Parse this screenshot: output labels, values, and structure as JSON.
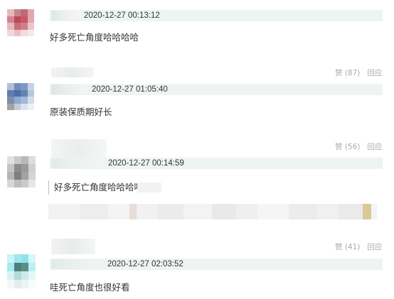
{
  "comments": [
    {
      "timestamp": "2020-12-27 00:13:12",
      "text": "好多死亡角度哈哈哈哈"
    },
    {
      "timestamp": "2020-12-27 01:05:40",
      "text": "原装保质期好长",
      "likes_label": "赞 (87)",
      "reply_label": "回应"
    },
    {
      "timestamp": "2020-12-27 00:14:59",
      "quote_text": "好多死亡角度哈哈哈哈",
      "likes_label": "赞 (56)",
      "reply_label": "回应"
    },
    {
      "timestamp": "2020-12-27 02:03:52",
      "text": "哇死亡角度也很好看",
      "likes_label": "赞 (41)",
      "reply_label": "回应"
    }
  ]
}
